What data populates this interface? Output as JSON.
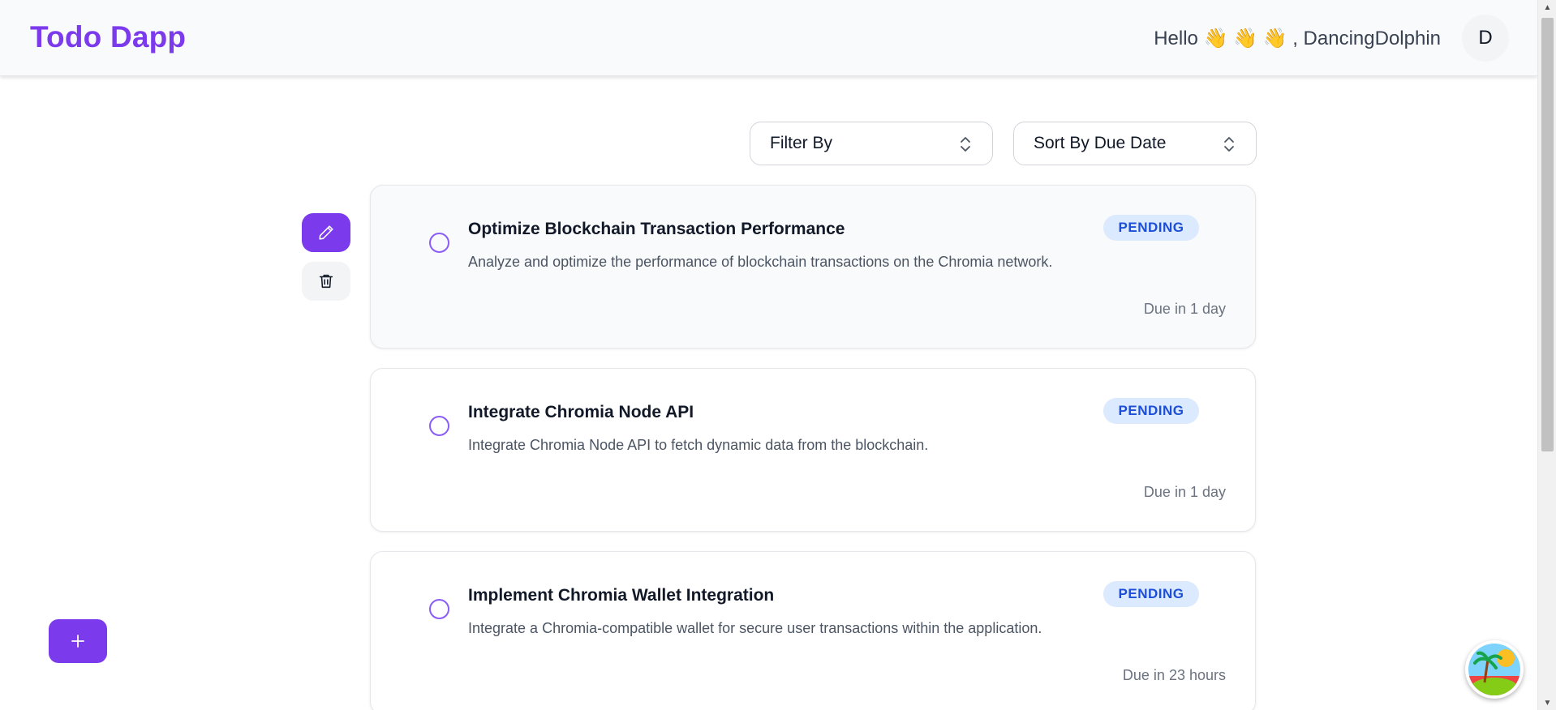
{
  "header": {
    "brand": "Todo Dapp",
    "greeting": "Hello 👋 👋 👋 , DancingDolphin",
    "avatar_initial": "D"
  },
  "controls": {
    "filter_label": "Filter By",
    "sort_label": "Sort By Due Date"
  },
  "tasks": [
    {
      "title": "Optimize Blockchain Transaction Performance",
      "description": "Analyze and optimize the performance of blockchain transactions on the Chromia network.",
      "status": "PENDING",
      "due": "Due in 1 day"
    },
    {
      "title": "Integrate Chromia Node API",
      "description": "Integrate Chromia Node API to fetch dynamic data from the blockchain.",
      "status": "PENDING",
      "due": "Due in 1 day"
    },
    {
      "title": "Implement Chromia Wallet Integration",
      "description": "Integrate a Chromia-compatible wallet for secure user transactions within the application.",
      "status": "PENDING",
      "due": "Due in 23 hours"
    }
  ],
  "colors": {
    "accent": "#7c3aed",
    "badge_bg": "#dbeafe",
    "badge_text": "#1d4ed8"
  },
  "icons": {
    "edit": "pencil-icon",
    "delete": "trash-icon",
    "add": "plus-icon",
    "select": "chevron-updown-icon"
  }
}
